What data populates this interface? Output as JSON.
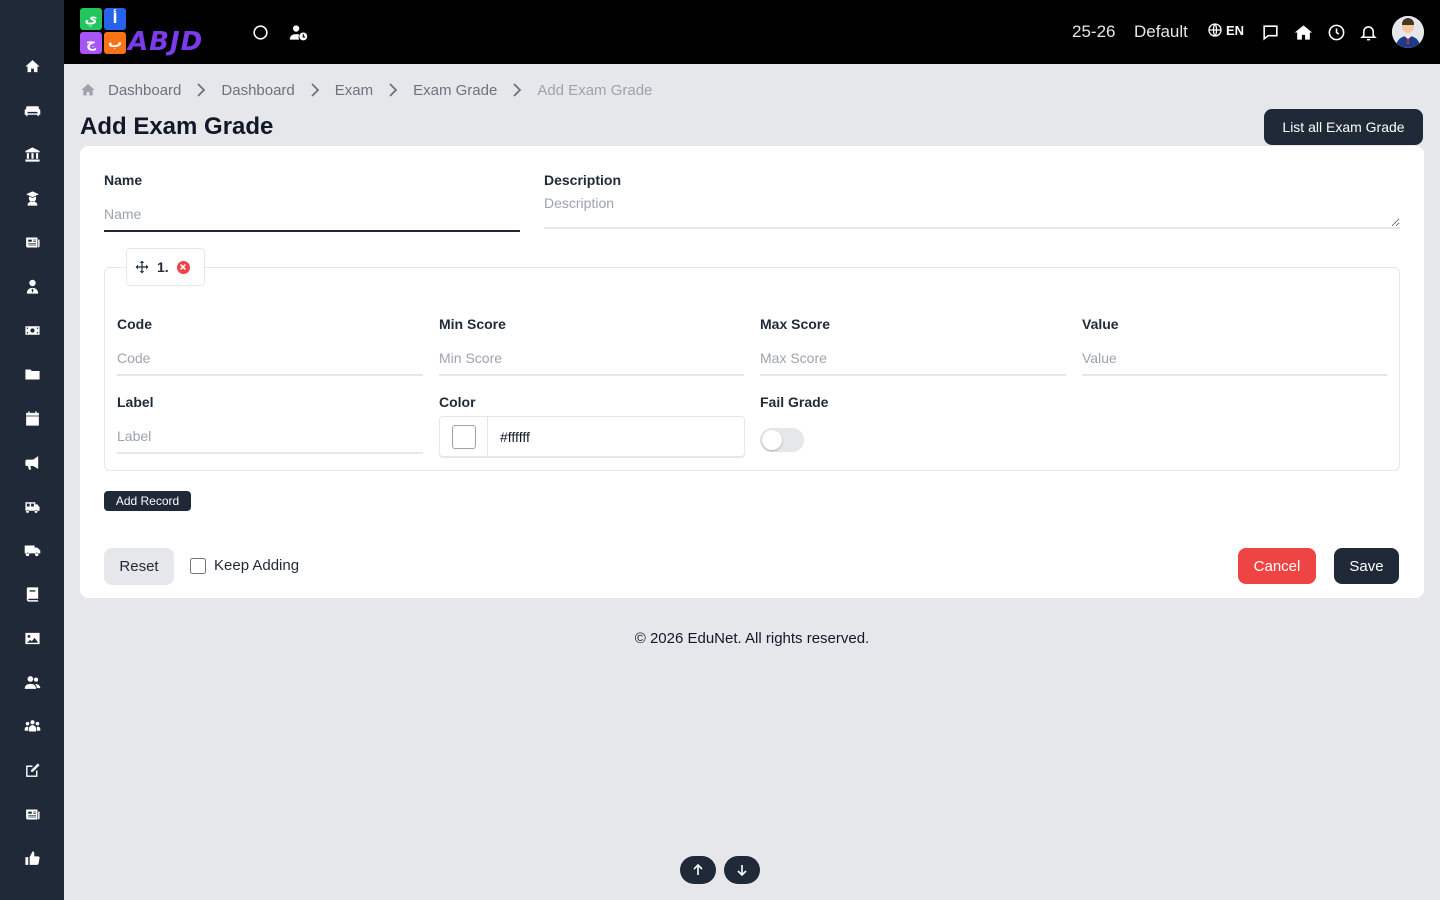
{
  "brand": {
    "logo_text": "ABJD",
    "tiles": [
      {
        "char": "ي",
        "color": "#22c55e"
      },
      {
        "char": "أ",
        "color": "#2563eb"
      },
      {
        "char": "ج",
        "color": "#a855f7"
      },
      {
        "char": "ب",
        "color": "#f97316"
      }
    ]
  },
  "topbar": {
    "year": "25-26",
    "profile": "Default",
    "language": "EN",
    "icons": [
      "circle-icon",
      "user-clock-icon",
      "globe-icon",
      "message-icon",
      "home-icon",
      "clock-icon",
      "bell-icon"
    ]
  },
  "sidebar": {
    "items": [
      "home-icon",
      "couch-icon",
      "bank-icon",
      "user-graduate-icon",
      "newspaper-icon",
      "user-tie-icon",
      "money-icon",
      "folder-icon",
      "calendar-icon",
      "megaphone-icon",
      "school-bus-icon",
      "truck-icon",
      "book-icon",
      "image-icon",
      "users-icon",
      "people-group-icon",
      "edit-icon",
      "news-icon",
      "thumbs-up-icon"
    ]
  },
  "breadcrumb": {
    "items": [
      "Dashboard",
      "Dashboard",
      "Exam",
      "Exam Grade"
    ],
    "current": "Add Exam Grade"
  },
  "page": {
    "title": "Add Exam Grade",
    "list_button": "List all Exam Grade"
  },
  "form": {
    "name": {
      "label": "Name",
      "placeholder": "Name",
      "value": ""
    },
    "description": {
      "label": "Description",
      "placeholder": "Description",
      "value": ""
    },
    "record": {
      "number": "1.",
      "code": {
        "label": "Code",
        "placeholder": "Code"
      },
      "min_score": {
        "label": "Min Score",
        "placeholder": "Min Score"
      },
      "max_score": {
        "label": "Max Score",
        "placeholder": "Max Score"
      },
      "value": {
        "label": "Value",
        "placeholder": "Value"
      },
      "label_field": {
        "label": "Label",
        "placeholder": "Label"
      },
      "color": {
        "label": "Color",
        "value": "#ffffff"
      },
      "fail_grade": {
        "label": "Fail Grade",
        "checked": false
      }
    },
    "add_record": "Add Record",
    "reset": "Reset",
    "keep_adding": "Keep Adding",
    "cancel": "Cancel",
    "save": "Save"
  },
  "footer": {
    "text": "© 2026 EduNet. All rights reserved."
  },
  "colors": {
    "sidebar_bg": "#1f2937",
    "topbar_bg": "#000000",
    "primary": "#1f2937",
    "danger": "#ef4444",
    "page_bg": "#e5e7eb"
  }
}
